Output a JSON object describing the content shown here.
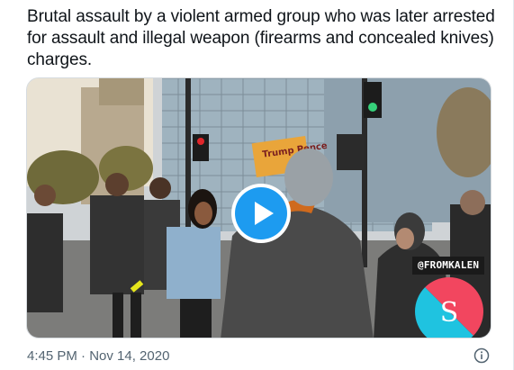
{
  "tweet": {
    "text": "Brutal assault by a violent armed group who was later arrested for assault and illegal weapon (firearms and concealed knives) charges.",
    "timestamp": "4:45 PM · Nov 14, 2020"
  },
  "video": {
    "watermark_handle": "@FROMKALEN",
    "sign_text": "Trump Pence",
    "logo_letter": "S"
  },
  "colors": {
    "play_button": "#1d9bf0",
    "timestamp": "#536471",
    "logo_blue": "#1fc3e0",
    "logo_red": "#f2465f"
  },
  "icons": {
    "play": "play-icon",
    "info": "info-icon"
  }
}
